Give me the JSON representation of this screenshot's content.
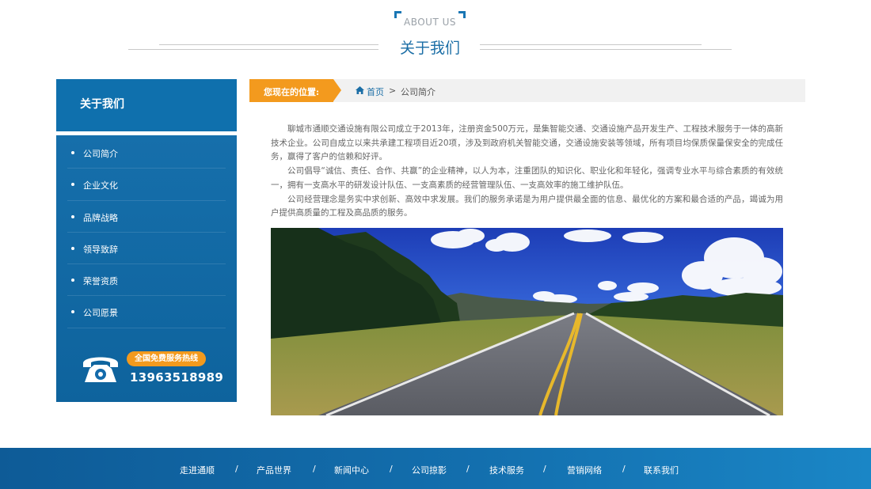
{
  "header": {
    "subtitle_en": "ABOUT US",
    "title": "关于我们"
  },
  "sidebar": {
    "title": "关于我们",
    "items": [
      {
        "label": "公司简介"
      },
      {
        "label": "企业文化"
      },
      {
        "label": "品牌战略"
      },
      {
        "label": "领导致辞"
      },
      {
        "label": "荣誉资质"
      },
      {
        "label": "公司愿景"
      }
    ],
    "hotline_label": "全国免费服务热线",
    "hotline_number": "13963518989"
  },
  "breadcrumb": {
    "prefix": "您现在的位置:",
    "home": "首页",
    "separator": ">",
    "current": "公司简介"
  },
  "content": {
    "paragraphs": [
      "聊城市通顺交通设施有限公司成立于2013年，注册资金500万元，是集智能交通、交通设施产品开发生产、工程技术服务于一体的高新技术企业。公司自成立以来共承建工程项目近20项，涉及到政府机关智能交通，交通设施安装等领域，所有项目均保质保量保安全的完成任务，赢得了客户的信赖和好评。",
      "公司倡导“诚信、责任、合作、共赢”的企业精神，以人为本，注重团队的知识化、职业化和年轻化，强调专业水平与综合素质的有效统一，拥有一支高水平的研发设计队伍、一支高素质的经营管理队伍、一支高效率的施工维护队伍。",
      "公司经营理念是务实中求创新、高效中求发展。我们的服务承诺是为用户提供最全面的信息、最优化的方案和最合适的产品，竭诚为用户提供高质量的工程及高品质的服务。"
    ]
  },
  "footer": {
    "links": [
      {
        "label": "走进通顺"
      },
      {
        "label": "产品世界"
      },
      {
        "label": "新闻中心"
      },
      {
        "label": "公司掠影"
      },
      {
        "label": "技术服务"
      },
      {
        "label": "营销网络"
      },
      {
        "label": "联系我们"
      }
    ],
    "separator": "/"
  },
  "colors": {
    "brand_blue": "#0f70ad",
    "accent_orange": "#f39a1e",
    "title_blue": "#1b6ea6"
  },
  "icons": [
    "phone-icon",
    "home-icon"
  ]
}
